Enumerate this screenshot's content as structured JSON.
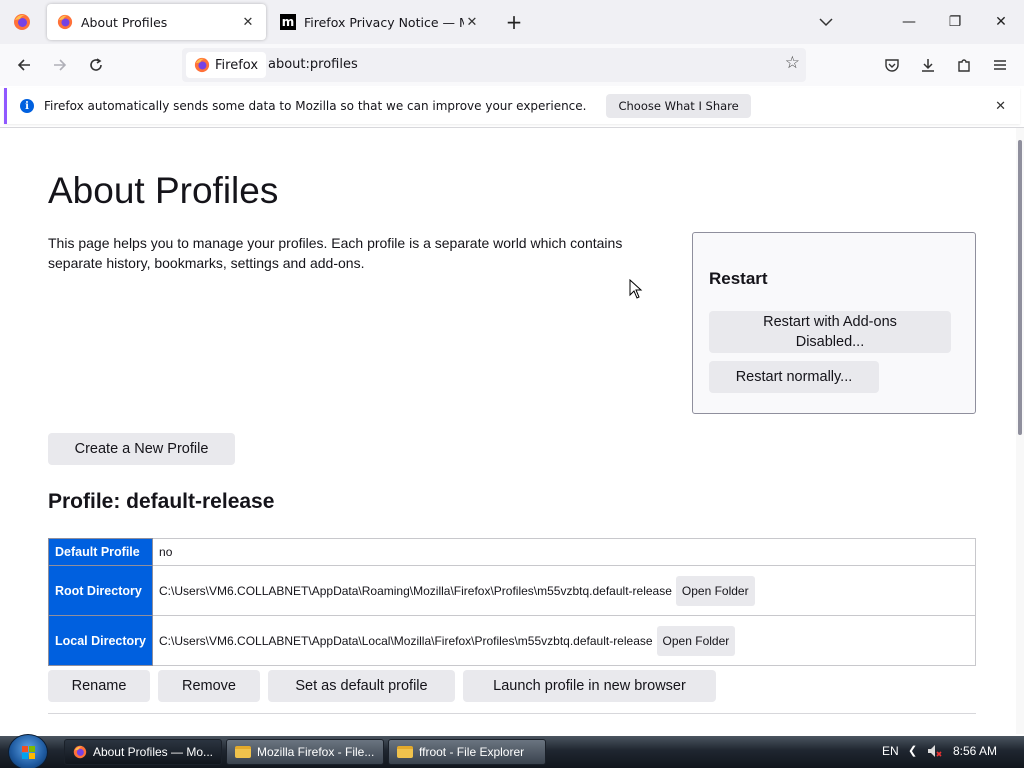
{
  "window": {
    "tabs": [
      {
        "title": "About Profiles",
        "active": true
      },
      {
        "title": "Firefox Privacy Notice — Mozilla",
        "active": false
      }
    ],
    "new_tab_label": "+",
    "list_tabs_icon": "chevron-down-icon",
    "controls": {
      "minimize": "—",
      "restore": "❐",
      "close": "✕"
    }
  },
  "navbar": {
    "identity_label": "Firefox",
    "url": "about:profiles"
  },
  "notification": {
    "message": "Firefox automatically sends some data to Mozilla so that we can improve your experience.",
    "button": "Choose What I Share"
  },
  "page": {
    "title": "About Profiles",
    "intro": "This page helps you to manage your profiles. Each profile is a separate world which contains separate history, bookmarks, settings and add-ons.",
    "restart": {
      "heading": "Restart",
      "disabled_button": "Restart with Add-ons Disabled...",
      "normal_button": "Restart normally..."
    },
    "create_button": "Create a New Profile",
    "profile": {
      "heading": "Profile: default-release",
      "rows": [
        {
          "label": "Default Profile",
          "value": "no"
        },
        {
          "label": "Root Directory",
          "value": "C:\\Users\\VM6.COLLABNET\\AppData\\Roaming\\Mozilla\\Firefox\\Profiles\\m55vzbtq.default-release",
          "button": "Open Folder"
        },
        {
          "label": "Local Directory",
          "value": "C:\\Users\\VM6.COLLABNET\\AppData\\Local\\Mozilla\\Firefox\\Profiles\\m55vzbtq.default-release",
          "button": "Open Folder"
        }
      ],
      "actions": [
        "Rename",
        "Remove",
        "Set as default profile",
        "Launch profile in new browser"
      ]
    }
  },
  "taskbar": {
    "items": [
      {
        "title": "About Profiles — Mo...",
        "active": true
      },
      {
        "title": "Mozilla Firefox - File...",
        "active": false
      },
      {
        "title": "ffroot - File Explorer",
        "active": false
      }
    ],
    "lang": "EN",
    "time": "8:56 AM"
  },
  "colors": {
    "accent": "#0060df",
    "notice_border": "#9059ff",
    "button_bg": "#e9e9ed"
  }
}
